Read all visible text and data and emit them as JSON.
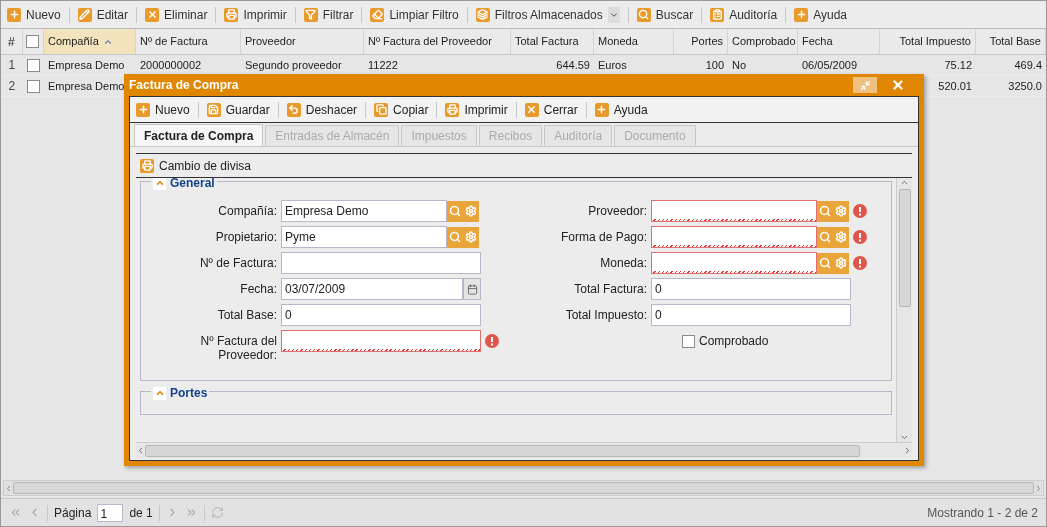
{
  "toolbar": [
    {
      "label": "Nuevo",
      "kind": "button"
    },
    {
      "label": "Editar",
      "kind": "button"
    },
    {
      "label": "Eliminar",
      "kind": "button"
    },
    {
      "label": "Imprimir",
      "kind": "button"
    },
    {
      "label": "Filtrar",
      "kind": "button"
    },
    {
      "label": "Limpiar Filtro",
      "kind": "button"
    },
    {
      "label": "Filtros Almacenados",
      "kind": "dropdown"
    },
    {
      "label": "Buscar",
      "kind": "button"
    },
    {
      "label": "Auditoría",
      "kind": "button"
    },
    {
      "label": "Ayuda",
      "kind": "button"
    }
  ],
  "grid": {
    "row_number_header": "#",
    "select_all_checked": false,
    "columns": [
      {
        "label": "Compañía",
        "sorted": true
      },
      {
        "label": "Nº de Factura",
        "sorted": false
      },
      {
        "label": "Proveedor",
        "sorted": false
      },
      {
        "label": "Nº Factura del Proveedor",
        "sorted": false
      },
      {
        "label": "Total Factura",
        "sorted": false
      },
      {
        "label": "Moneda",
        "sorted": false
      },
      {
        "label": "Portes",
        "sorted": false
      },
      {
        "label": "Comprobado",
        "sorted": false
      },
      {
        "label": "Fecha",
        "sorted": false
      },
      {
        "label": "Total Impuesto",
        "sorted": false
      },
      {
        "label": "Total Base",
        "sorted": false
      }
    ],
    "rows": [
      {
        "number": "1",
        "checked": false,
        "cells": [
          "Empresa Demo",
          "2000000002",
          "Segundo proveedor",
          "11222",
          "644.59",
          "Euros",
          "100",
          "No",
          "06/05/2009",
          "75.12",
          "469.4"
        ]
      },
      {
        "number": "2",
        "checked": false,
        "cells": [
          "Empresa Demo",
          null,
          null,
          null,
          null,
          null,
          null,
          null,
          null,
          "520.01",
          "3250.0"
        ]
      }
    ]
  },
  "dialog": {
    "title": "Factura de Compra",
    "toolbar": [
      {
        "label": "Nuevo"
      },
      {
        "label": "Guardar"
      },
      {
        "label": "Deshacer"
      },
      {
        "label": "Copiar"
      },
      {
        "label": "Imprimir"
      },
      {
        "label": "Cerrar"
      },
      {
        "label": "Ayuda"
      }
    ],
    "tabs": [
      {
        "label": "Factura de Compra",
        "selected": true,
        "disabled": false
      },
      {
        "label": "Entradas de Almacén",
        "selected": false,
        "disabled": true
      },
      {
        "label": "Impuestos",
        "selected": false,
        "disabled": true
      },
      {
        "label": "Recibos",
        "selected": false,
        "disabled": true
      },
      {
        "label": "Auditoría",
        "selected": false,
        "disabled": true
      },
      {
        "label": "Documento",
        "selected": false,
        "disabled": true
      }
    ],
    "subtoolbar": [
      {
        "label": "Cambio de divisa"
      }
    ],
    "sections": [
      {
        "title": "General",
        "expanded": true,
        "left": [
          {
            "label": "Compañía:",
            "value": "Empresa Demo",
            "kind": "lookup",
            "invalid": false
          },
          {
            "label": "Propietario:",
            "value": "Pyme",
            "kind": "lookup",
            "invalid": false
          },
          {
            "label": "Nº de Factura:",
            "kind": "text",
            "invalid": false
          },
          {
            "label": "Fecha:",
            "value": "03/07/2009",
            "kind": "date",
            "invalid": false
          },
          {
            "label": "Total Base:",
            "value": "0",
            "kind": "text",
            "invalid": false
          },
          {
            "label": "Nº Factura del Proveedor:",
            "kind": "text",
            "invalid": true
          }
        ],
        "right": [
          {
            "label": "Proveedor:",
            "kind": "lookup",
            "invalid": true
          },
          {
            "label": "Forma de Pago:",
            "kind": "lookup",
            "invalid": true
          },
          {
            "label": "Moneda:",
            "kind": "lookup",
            "invalid": true
          },
          {
            "label": "Total Factura:",
            "value": "0",
            "kind": "text",
            "invalid": false
          },
          {
            "label": "Total Impuesto:",
            "value": "0",
            "kind": "text",
            "invalid": false
          },
          {
            "label": "Comprobado",
            "kind": "checkbox",
            "checked": false
          }
        ]
      },
      {
        "title": "Portes",
        "expanded": true
      }
    ]
  },
  "paging": {
    "page_label": "Página",
    "page": "1",
    "of_label": "de 1",
    "summary": "Mostrando 1 - 2 de 2"
  }
}
